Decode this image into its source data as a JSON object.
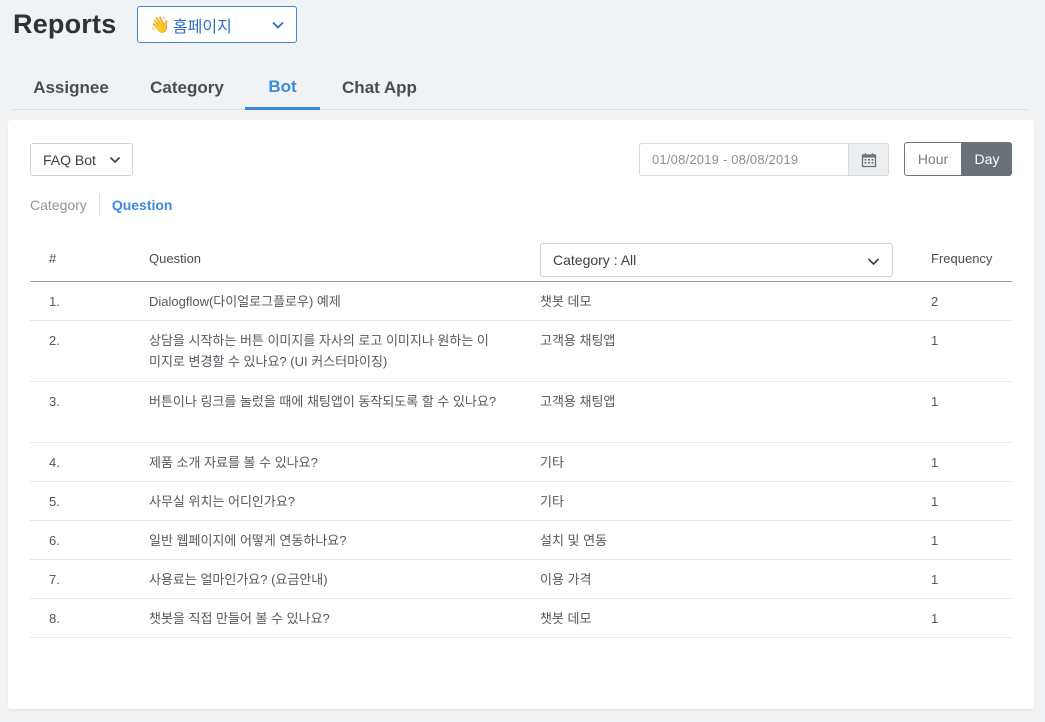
{
  "header": {
    "title": "Reports",
    "site_emoji": "👋",
    "site_name": "홈페이지"
  },
  "tabs": [
    {
      "label": "Assignee"
    },
    {
      "label": "Category"
    },
    {
      "label": "Bot"
    },
    {
      "label": "Chat App"
    }
  ],
  "active_tab": "Bot",
  "toolbar": {
    "bot_select": "FAQ Bot",
    "date_range": "01/08/2019 - 08/08/2019",
    "hour_label": "Hour",
    "day_label": "Day",
    "selected_granularity": "Day"
  },
  "subtabs": [
    {
      "label": "Category"
    },
    {
      "label": "Question"
    }
  ],
  "active_subtab": "Question",
  "table": {
    "headers": {
      "num": "#",
      "question": "Question",
      "category_filter": "Category : All",
      "frequency": "Frequency"
    },
    "rows": [
      {
        "num": "1.",
        "question": "Dialogflow(다이얼로그플로우) 예제",
        "category": "챗봇 데모",
        "frequency": "2"
      },
      {
        "num": "2.",
        "question": "상담을 시작하는 버튼 이미지를 자사의 로고 이미지나 원하는 이미지로 변경할 수 있나요? (UI 커스터마이징)",
        "category": "고객용 채팅앱",
        "frequency": "1"
      },
      {
        "num": "3.",
        "question": "버튼이나 링크를 눌렀을 때에 채팅앱이 동작되도록 할 수 있나요?",
        "category": "고객용 채팅앱",
        "frequency": "1"
      },
      {
        "num": "4.",
        "question": "제품 소개 자료를 볼 수 있나요?",
        "category": "기타",
        "frequency": "1"
      },
      {
        "num": "5.",
        "question": "사무실 위치는 어디인가요?",
        "category": "기타",
        "frequency": "1"
      },
      {
        "num": "6.",
        "question": "일반 웹페이지에 어떻게 연동하나요?",
        "category": "설치 및 연동",
        "frequency": "1"
      },
      {
        "num": "7.",
        "question": "사용료는 얼마인가요? (요금안내)",
        "category": "이용 가격",
        "frequency": "1"
      },
      {
        "num": "8.",
        "question": "챗봇을 직접 만들어 볼 수 있나요?",
        "category": "챗봇 데모",
        "frequency": "1"
      }
    ]
  },
  "colors": {
    "accent": "#3b8ae0",
    "background": "#f1f2f4",
    "toggle_active": "#6b7178"
  }
}
